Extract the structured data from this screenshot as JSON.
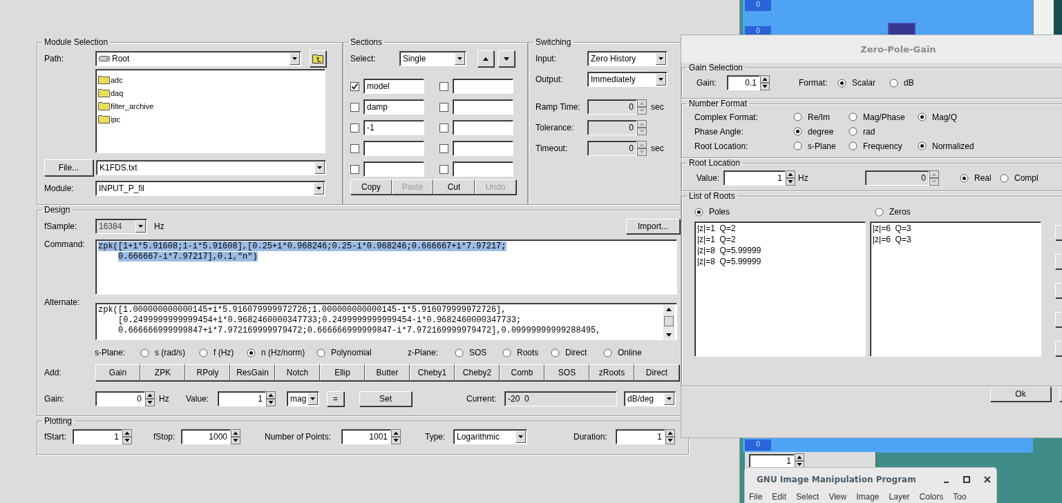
{
  "main": {
    "module_selection": {
      "title": "Module Selection",
      "path_label": "Path:",
      "path": "Root",
      "folders": [
        "adc",
        "daq",
        "filter_archive",
        "ipc"
      ],
      "file_button": "File...",
      "file": "K1FDS.txt",
      "module_label": "Module:",
      "module": "INPUT_P_fil"
    },
    "sections": {
      "title": "Sections",
      "select_label": "Select:",
      "select": "Single",
      "slots": [
        [
          {
            "value": "model",
            "checked": true
          },
          {
            "checked": false
          }
        ],
        [
          {
            "value": "damp",
            "checked": false
          },
          {
            "checked": false
          }
        ],
        [
          {
            "value": "-1",
            "checked": false
          },
          {
            "checked": false
          }
        ],
        [
          {
            "checked": false
          },
          {
            "checked": false
          }
        ],
        [
          {
            "checked": false
          },
          {
            "checked": false
          }
        ]
      ],
      "buttons": [
        {
          "label": "Copy",
          "disabled": false
        },
        {
          "label": "Paste",
          "disabled": true
        },
        {
          "label": "Cut",
          "disabled": false
        },
        {
          "label": "Undo",
          "disabled": true
        }
      ]
    },
    "switching": {
      "title": "Switching",
      "input_label": "Input:",
      "input": "Zero History",
      "output_label": "Output:",
      "output": "Immediately",
      "fields": [
        {
          "label": "Ramp Time:",
          "value": "0",
          "unit": "sec",
          "disabled": true
        },
        {
          "label": "Tolerance:",
          "value": "0",
          "disabled": true
        },
        {
          "label": "Timeout:",
          "value": "0",
          "unit": "sec",
          "disabled": true
        }
      ]
    },
    "design": {
      "title": "Design",
      "fsample_label": "fSample:",
      "fsample": "16384",
      "fsample_disabled": true,
      "fsample_unit": "Hz",
      "import_button": "Import...",
      "command_label": "Command:",
      "command": {
        "selected": true,
        "lines": [
          "zpk([1+i*5.91608;1-i*5.91608],[0.25+i*0.968246;0.25-i*0.968246;0.666667+i*7.97217;",
          "0.666667-i*7.97217],0.1,\"n\")"
        ]
      },
      "alternate_label": "Alternate:",
      "alternate": [
        "zpk([1.000000000000145+i*5.916079999972726;1.000000000000145-i*5.916079999972726],",
        "[0.2499999999999454+i*0.9682460000347733;0.2499999999999454-i*0.9682460000347733;",
        "0.666666999999847+i*7.972169999979472;0.666666999999847-i*7.972169999979472],0.09999999999288495,"
      ],
      "s_plane": {
        "label": "s-Plane:",
        "options": [
          {
            "label": "s (rad/s)",
            "selected": false
          },
          {
            "label": "f (Hz)",
            "selected": false
          },
          {
            "label": "n (Hz/norm)",
            "selected": true
          },
          {
            "label": "Polynomial",
            "selected": false
          }
        ]
      },
      "z_plane": {
        "label": "z-Plane:",
        "options": [
          {
            "label": "SOS",
            "selected": false
          },
          {
            "label": "Roots",
            "selected": false
          },
          {
            "label": "Direct",
            "selected": false
          },
          {
            "label": "Online",
            "selected": false
          }
        ]
      },
      "add_label": "Add:",
      "add_buttons": [
        "Gain",
        "ZPK",
        "RPoly",
        "ResGain",
        "Notch",
        "Ellip",
        "Butter",
        "Cheby1",
        "Cheby2",
        "Comb",
        "SOS",
        "zRoots",
        "Direct"
      ],
      "gain_label": "Gain:",
      "gain": "0",
      "gain_unit": "Hz",
      "value_label": "Value:",
      "value": "1",
      "value_unit": "mag",
      "equals_button": "=",
      "set_button": "Set",
      "current_label": "Current:",
      "current": "-20  0",
      "current_unit": "dB/deg"
    },
    "plotting": {
      "title": "Plotting",
      "fields": [
        {
          "kind": "spin",
          "label": "fStart:",
          "value": "1"
        },
        {
          "kind": "spin",
          "label": "fStop:",
          "value": "1000"
        },
        {
          "kind": "spin",
          "label": "Number of Points:",
          "value": "1001"
        },
        {
          "kind": "select",
          "label": "Type:",
          "value": "Logarithmic"
        },
        {
          "kind": "spin",
          "label": "Duration:",
          "value": "1"
        }
      ]
    }
  },
  "dialog": {
    "title": "Zero-Pole-Gain",
    "gain_selection": {
      "title": "Gain Selection",
      "gain_label": "Gain:",
      "gain": "0.1",
      "format_label": "Format:",
      "formats": [
        {
          "label": "Scalar",
          "selected": true
        },
        {
          "label": "dB",
          "selected": false
        }
      ]
    },
    "number_format": {
      "title": "Number Format",
      "rows": [
        {
          "label": "Complex Format:",
          "options": [
            {
              "label": "Re/Im",
              "selected": false
            },
            {
              "label": "Mag/Phase",
              "selected": false
            },
            {
              "label": "Mag/Q",
              "selected": true
            }
          ]
        },
        {
          "label": "Phase Angle:",
          "options": [
            {
              "label": "degree",
              "selected": true
            },
            {
              "label": "rad",
              "selected": false
            }
          ]
        },
        {
          "label": "Root Location:",
          "options": [
            {
              "label": "s-Plane",
              "selected": false
            },
            {
              "label": "Frequency",
              "selected": false
            },
            {
              "label": "Normalized",
              "selected": true
            }
          ]
        }
      ]
    },
    "root_location": {
      "title": "Root Location",
      "value_label": "Value:",
      "value": "1",
      "unit": "Hz",
      "imaginary": "0",
      "imaginary_disabled": true,
      "types": [
        {
          "label": "Real",
          "selected": true
        },
        {
          "label": "Compl",
          "selected": false
        }
      ]
    },
    "list_of_roots": {
      "title": "List of Roots",
      "lists": [
        {
          "label": "Poles",
          "selected": true,
          "items": [
            "|z|=1  Q=2",
            "|z|=1  Q=2",
            "|z|=8  Q=5.99999",
            "|z|=8  Q=5.99999"
          ]
        },
        {
          "label": "Zeros",
          "selected": false,
          "items": [
            "|z|=6  Q=3",
            "|z|=6  Q=3"
          ]
        }
      ]
    },
    "ok_button": "Ok"
  },
  "desktop": {
    "labels": [
      "0",
      "0",
      "0"
    ],
    "spin_value": "1"
  },
  "gimp": {
    "title": "GNU Image Manipulation Program",
    "menu": [
      "File",
      "Edit",
      "Select",
      "View",
      "Image",
      "Layer",
      "Colors",
      "Too"
    ]
  }
}
